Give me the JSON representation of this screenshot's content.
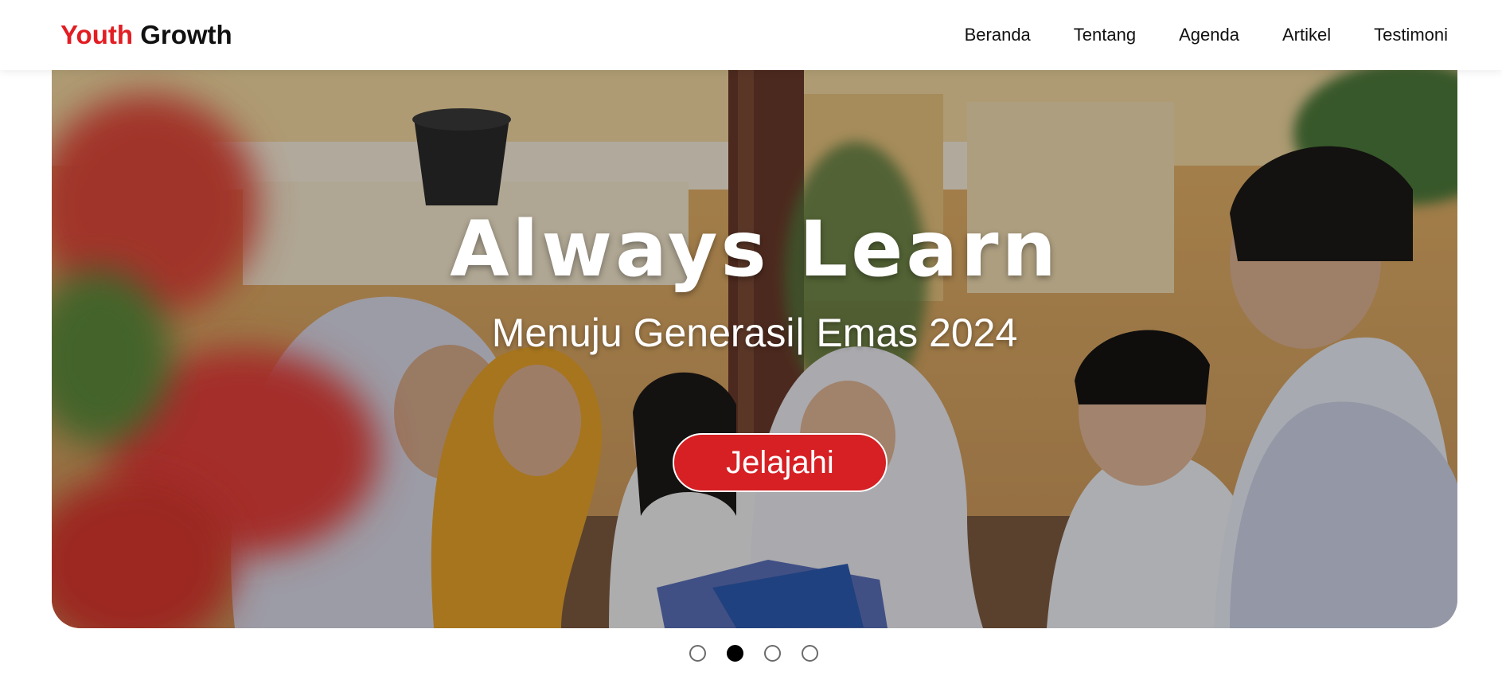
{
  "navbar": {
    "brand_part1": "Youth",
    "brand_part2": "Growth",
    "brand_colors": {
      "part1": "#e21d23",
      "part2": "#111111"
    },
    "menu": [
      {
        "label": "Beranda"
      },
      {
        "label": "Tentang"
      },
      {
        "label": "Agenda"
      },
      {
        "label": "Artikel"
      },
      {
        "label": "Testimoni"
      }
    ]
  },
  "hero": {
    "title": "Always Learn",
    "subtitle": "Menuju Generasi| Emas 2024",
    "cta_label": "Jelajahi",
    "cta_color": "#d62024",
    "image": "students-studying-photo"
  },
  "carousel": {
    "slide_count": 4,
    "active_index": 1
  }
}
